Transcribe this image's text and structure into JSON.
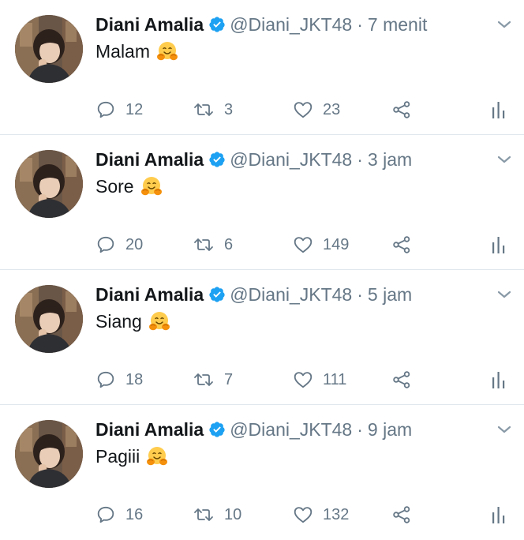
{
  "colors": {
    "text": "#14171a",
    "secondary": "#657786",
    "verified": "#1da1f2",
    "divider": "#e1e8ed"
  },
  "tweets": [
    {
      "name": "Diani Amalia",
      "handle": "@Diani_JKT48",
      "separator": "·",
      "time": "7 menit",
      "text": "Malam",
      "emoji": "hugging-face-icon",
      "replies": "12",
      "retweets": "3",
      "likes": "23"
    },
    {
      "name": "Diani Amalia",
      "handle": "@Diani_JKT48",
      "separator": "·",
      "time": "3 jam",
      "text": "Sore",
      "emoji": "hugging-face-icon",
      "replies": "20",
      "retweets": "6",
      "likes": "149"
    },
    {
      "name": "Diani Amalia",
      "handle": "@Diani_JKT48",
      "separator": "·",
      "time": "5 jam",
      "text": "Siang",
      "emoji": "hugging-face-icon",
      "replies": "18",
      "retweets": "7",
      "likes": "111"
    },
    {
      "name": "Diani Amalia",
      "handle": "@Diani_JKT48",
      "separator": "·",
      "time": "9 jam",
      "text": "Pagiii",
      "emoji": "hugging-face-icon",
      "replies": "16",
      "retweets": "10",
      "likes": "132"
    }
  ]
}
